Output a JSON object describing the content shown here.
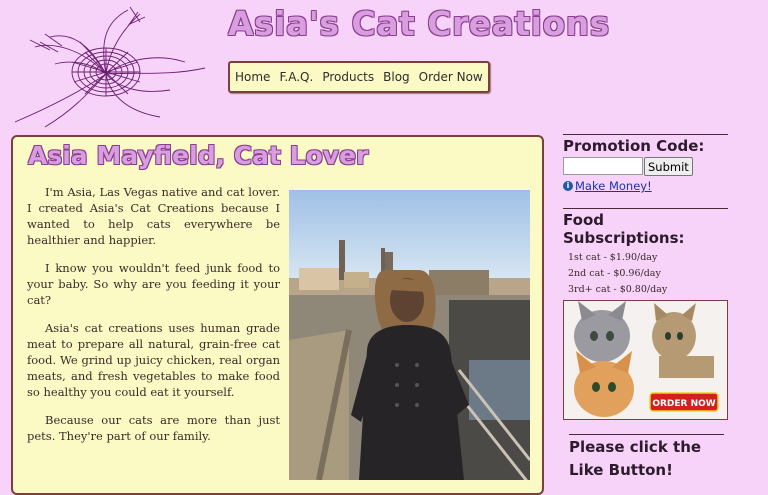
{
  "site": {
    "title": "Asia's Cat Creations"
  },
  "nav": {
    "items": [
      "Home",
      "F.A.Q.",
      "Products",
      "Blog",
      "Order Now"
    ]
  },
  "main": {
    "heading": "Asia Mayfield, Cat Lover",
    "paragraphs": [
      "I'm Asia, Las Vegas native and cat lover. I created Asia's Cat Creations because I wanted to help cats everywhere be healthier and happier.",
      "I know you wouldn't feed junk food to your baby. So why are you feeding it your cat?",
      "Asia's cat creations uses human grade meat to prepare all natural, grain-free cat food. We grind up juicy chicken, real organ meats, and fresh vegetables to make food so healthy you could eat it yourself.",
      "Because our cats are more than just pets. They're part of our family."
    ]
  },
  "sidebar": {
    "promo": {
      "title": "Promotion Code:",
      "input_value": "",
      "submit_label": "Submit",
      "link": "Make Money!"
    },
    "food": {
      "title": "Food Subscriptions:",
      "prices": [
        "1st cat - $1.90/day",
        "2nd cat - $0.96/day",
        "3rd+ cat - $0.80/day"
      ],
      "image_button": "ORDER NOW"
    },
    "like": {
      "line1": "Please click the",
      "line2": "Like Button!"
    }
  },
  "colors": {
    "background": "#f7d2f9",
    "panel": "#fbf9c4",
    "border": "#7a3f3f",
    "title_fill": "#d99ee0",
    "title_outline": "#8a3f8f",
    "link": "#2233aa"
  },
  "icons": [
    "cat-sketch-logo",
    "info-icon"
  ]
}
